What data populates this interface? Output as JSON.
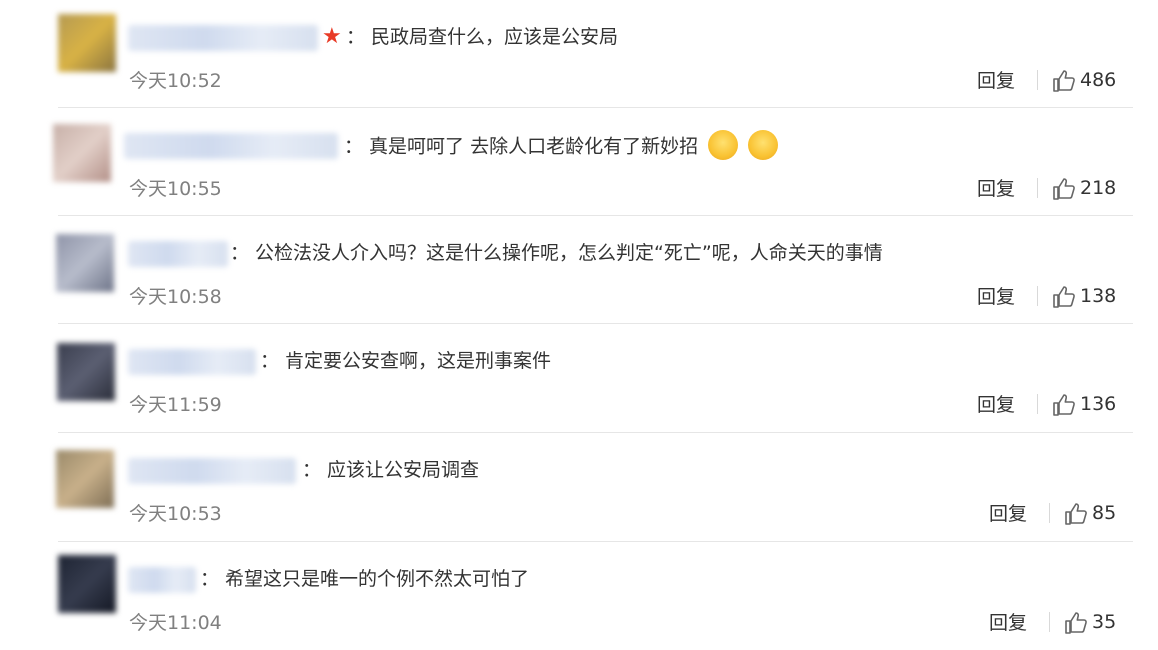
{
  "ui": {
    "reply_label": "回复"
  },
  "comments": [
    {
      "text": "：  民政局查什么，应该是公安局",
      "time": "今天10:52",
      "likes": "486",
      "has_star": true
    },
    {
      "text": "：  真是呵呵了 去除人口老龄化有了新妙招",
      "time": "今天10:55",
      "likes": "218",
      "emoji_count": 2
    },
    {
      "text": "：  公检法没人介入吗？这是什么操作呢，怎么判定“死亡”呢，人命关天的事情",
      "time": "今天10:58",
      "likes": "138"
    },
    {
      "text": "：  肯定要公安查啊，这是刑事案件",
      "time": "今天11:59",
      "likes": "136"
    },
    {
      "text": "：  应该让公安局调查",
      "time": "今天10:53",
      "likes": "85"
    },
    {
      "text": "：  希望这只是唯一的个例不然太可怕了",
      "time": "今天11:04",
      "likes": "35"
    }
  ],
  "colors": {
    "star": "#e83a26",
    "time": "#808080",
    "divider": "#e6e6e6",
    "name_blur": "#d5def0"
  },
  "icons": [
    "star-icon",
    "thumbs-up-icon",
    "smiling-face-emoji-icon"
  ]
}
